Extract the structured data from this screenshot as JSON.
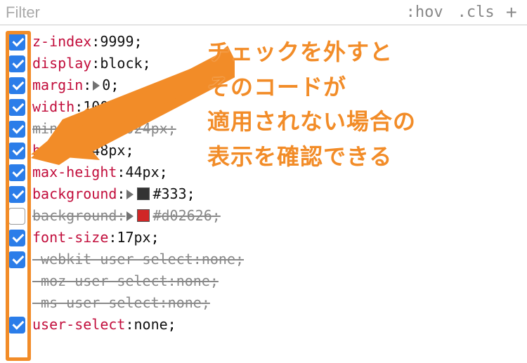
{
  "toolbar": {
    "filter": "Filter",
    "hov": ":hov",
    "cls": ".cls"
  },
  "props": [
    {
      "checked": true,
      "name": "z-index",
      "value": "9999",
      "overridden": false
    },
    {
      "checked": true,
      "name": "display",
      "value": "block",
      "overridden": false
    },
    {
      "checked": true,
      "name": "margin",
      "value": "0",
      "overridden": false,
      "expandable": true
    },
    {
      "checked": true,
      "name": "width",
      "value": "100%",
      "overridden": false
    },
    {
      "checked": true,
      "name": "min-width",
      "value": "1024px",
      "overridden": true
    },
    {
      "checked": true,
      "name": "height",
      "value": "48px",
      "overridden": false
    },
    {
      "checked": true,
      "name": "max-height",
      "value": "44px",
      "overridden": false
    },
    {
      "checked": true,
      "name": "background",
      "value": "#333",
      "overridden": false,
      "expandable": true,
      "swatch": "#333333"
    },
    {
      "checked": false,
      "name": "background",
      "value": "#d02626",
      "overridden": true,
      "expandable": true,
      "swatch": "#d02626"
    },
    {
      "checked": true,
      "name": "font-size",
      "value": "17px",
      "overridden": false
    },
    {
      "checked": true,
      "name": "-webkit-user-select",
      "value": "none",
      "overridden": true
    },
    {
      "checked": false,
      "name": "-moz-user-select",
      "value": "none",
      "overridden": true,
      "nocb": true
    },
    {
      "checked": false,
      "name": "-ms-user-select",
      "value": "none",
      "overridden": true,
      "nocb": true
    },
    {
      "checked": true,
      "name": "user-select",
      "value": "none",
      "overridden": false
    }
  ],
  "annotation": {
    "line1": "チェックを外すと",
    "line2": "そのコードが",
    "line3": "適用されない場合の",
    "line4": "表示を確認できる"
  }
}
